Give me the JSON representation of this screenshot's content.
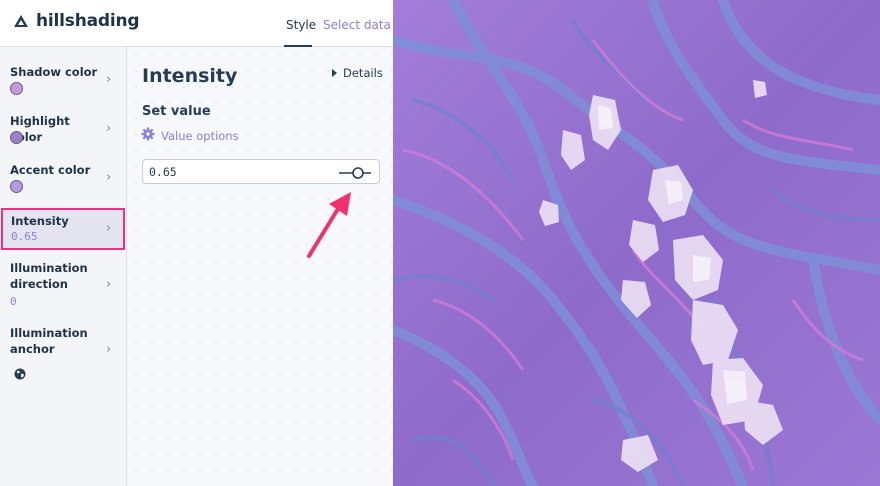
{
  "header": {
    "layer_name": "hillshading",
    "tabs": [
      "Style",
      "Select data"
    ],
    "active_tab": "Style"
  },
  "sidebar": {
    "items": [
      {
        "label": "Shadow color",
        "swatch": "#c59ad8"
      },
      {
        "label": "Highlight color",
        "swatch": "#9b7fc8"
      },
      {
        "label": "Accent color",
        "swatch": "#b39ce3"
      },
      {
        "label": "Intensity",
        "value": "0.65",
        "selected": true
      },
      {
        "label": "Illumination direction",
        "value": "0"
      },
      {
        "label": "Illumination anchor",
        "icon": "globe-icon"
      }
    ]
  },
  "main": {
    "title": "Intensity",
    "details_label": "Details",
    "section_label": "Set value",
    "value_options_label": "Value options",
    "input_value": "0.65"
  },
  "colors": {
    "accent": "#8a7fd6",
    "highlight_border": "#ef2e86",
    "map_base": "#8f6fcf",
    "map_highlight": "#f1e8f7"
  },
  "icons": [
    "mountain-icon",
    "chevron-right-icon",
    "gear-icon",
    "slider-icon",
    "globe-icon",
    "caret-right-icon"
  ]
}
